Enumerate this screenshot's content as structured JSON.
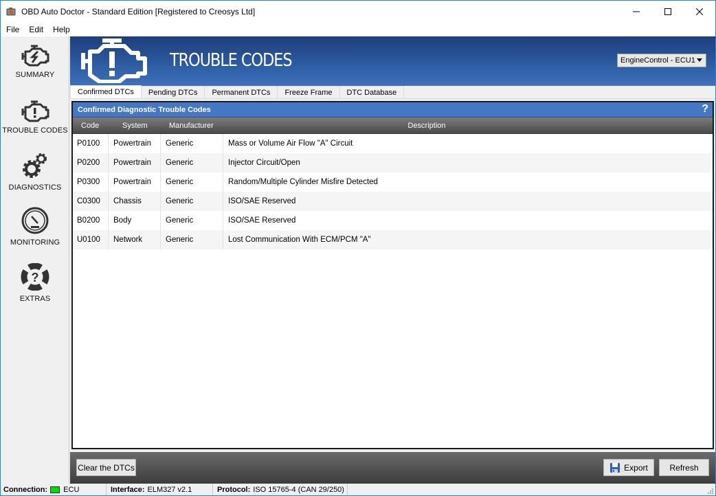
{
  "window": {
    "title": "OBD Auto Doctor - Standard Edition [Registered to Creosys Ltd]",
    "controls": {
      "minimize": "minimize-icon",
      "maximize": "maximize-icon",
      "close": "close-icon"
    }
  },
  "menu": [
    {
      "label": "File"
    },
    {
      "label": "Edit"
    },
    {
      "label": "Help"
    }
  ],
  "sidebar": {
    "items": [
      {
        "label": "SUMMARY",
        "icon": "engine-bolt-icon"
      },
      {
        "label": "TROUBLE CODES",
        "icon": "check-engine-icon"
      },
      {
        "label": "DIAGNOSTICS",
        "icon": "gears-icon"
      },
      {
        "label": "MONITORING",
        "icon": "gauge-icon"
      },
      {
        "label": "EXTRAS",
        "icon": "lifebuoy-question-icon"
      }
    ]
  },
  "header": {
    "title": "TROUBLE CODES",
    "icon": "check-engine-icon",
    "ecu_select": {
      "value": "EngineControl - ECU1"
    }
  },
  "tabs": [
    {
      "label": "Confirmed DTCs",
      "active": true
    },
    {
      "label": "Pending DTCs",
      "active": false
    },
    {
      "label": "Permanent DTCs",
      "active": false
    },
    {
      "label": "Freeze Frame",
      "active": false
    },
    {
      "label": "DTC Database",
      "active": false
    }
  ],
  "panel": {
    "title": "Confirmed Diagnostic Trouble Codes",
    "help": "?",
    "columns": {
      "code": "Code",
      "system": "System",
      "manufacturer": "Manufacturer",
      "description": "Description"
    },
    "rows": [
      {
        "code": "P0100",
        "system": "Powertrain",
        "manufacturer": "Generic",
        "description": "Mass or Volume Air Flow \"A\" Circuit"
      },
      {
        "code": "P0200",
        "system": "Powertrain",
        "manufacturer": "Generic",
        "description": "Injector Circuit/Open"
      },
      {
        "code": "P0300",
        "system": "Powertrain",
        "manufacturer": "Generic",
        "description": "Random/Multiple Cylinder Misfire Detected"
      },
      {
        "code": "C0300",
        "system": "Chassis",
        "manufacturer": "Generic",
        "description": "ISO/SAE Reserved"
      },
      {
        "code": "B0200",
        "system": "Body",
        "manufacturer": "Generic",
        "description": "ISO/SAE Reserved"
      },
      {
        "code": "U0100",
        "system": "Network",
        "manufacturer": "Generic",
        "description": "Lost Communication With ECM/PCM \"A\""
      }
    ]
  },
  "toolbar": {
    "clear_label": "Clear the DTCs",
    "export_label": "Export",
    "refresh_label": "Refresh"
  },
  "status": {
    "connection_label": "Connection:",
    "connection_value": "ECU",
    "connection_color": "#00e000",
    "interface_label": "Interface:",
    "interface_value": "ELM327 v2.1",
    "protocol_label": "Protocol:",
    "protocol_value": "ISO 15765-4 (CAN 29/250)"
  }
}
